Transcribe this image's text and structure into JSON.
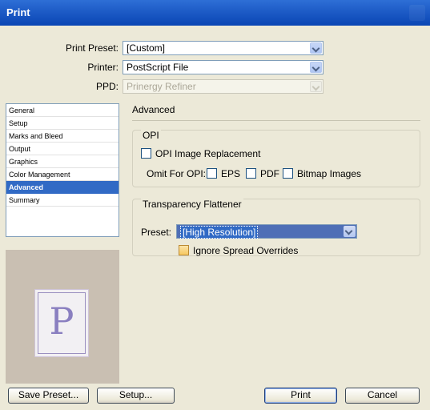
{
  "window": {
    "title": "Print"
  },
  "top_fields": {
    "print_preset": {
      "label": "Print Preset:",
      "value": "[Custom]"
    },
    "printer": {
      "label": "Printer:",
      "value": "PostScript File"
    },
    "ppd": {
      "label": "PPD:",
      "value": "Prinergy Refiner"
    }
  },
  "sidebar": {
    "items": [
      {
        "label": "General",
        "active": false
      },
      {
        "label": "Setup",
        "active": false
      },
      {
        "label": "Marks and Bleed",
        "active": false
      },
      {
        "label": "Output",
        "active": false
      },
      {
        "label": "Graphics",
        "active": false
      },
      {
        "label": "Color Management",
        "active": false
      },
      {
        "label": "Advanced",
        "active": true
      },
      {
        "label": "Summary",
        "active": false
      }
    ]
  },
  "preview": {
    "glyph": "P"
  },
  "main": {
    "section_title": "Advanced",
    "opi": {
      "title": "OPI",
      "image_replacement_label": "OPI Image Replacement",
      "image_replacement_checked": false,
      "omit_label": "Omit For OPI:",
      "omit_options": [
        {
          "label": "EPS",
          "checked": false
        },
        {
          "label": "PDF",
          "checked": false
        },
        {
          "label": "Bitmap Images",
          "checked": false
        }
      ]
    },
    "flattener": {
      "title": "Transparency Flattener",
      "preset_label": "Preset:",
      "preset_value": "[High Resolution]",
      "ignore_overrides_label": "Ignore Spread Overrides",
      "ignore_overrides_checked": false
    }
  },
  "buttons": {
    "save_preset": "Save Preset...",
    "setup": "Setup...",
    "print": "Print",
    "cancel": "Cancel"
  },
  "colors": {
    "titlebar": "#0a46b4",
    "selection": "#316ac5",
    "dialog_bg": "#ece9d8"
  }
}
